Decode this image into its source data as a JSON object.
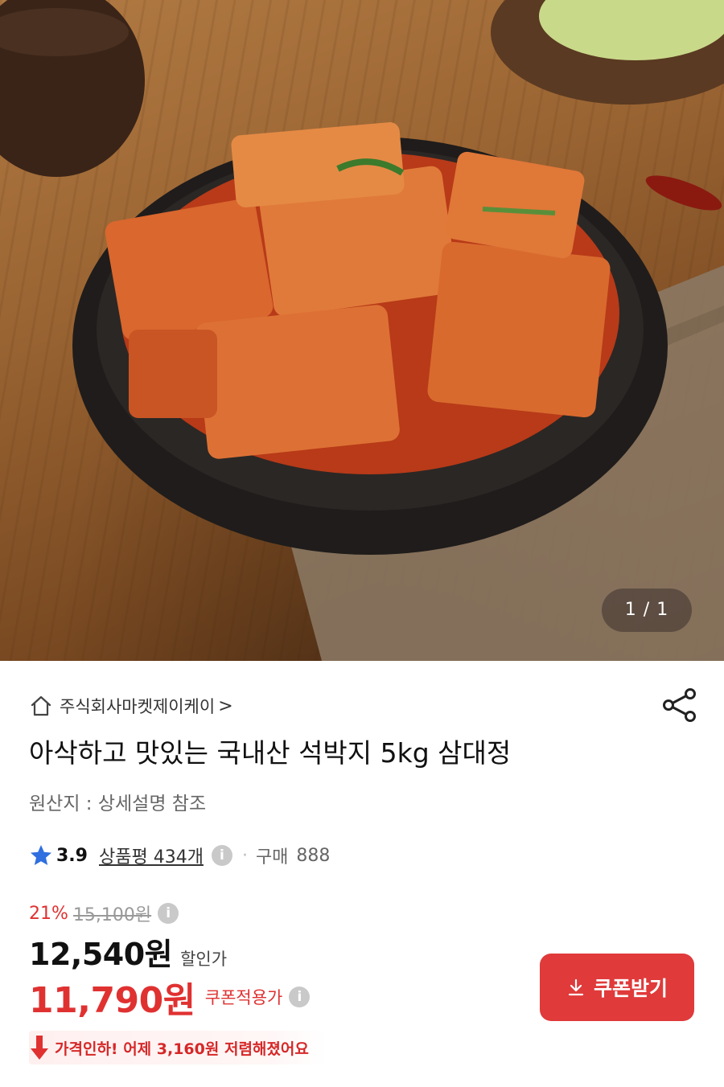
{
  "gallery": {
    "counter": "1 / 1"
  },
  "seller": {
    "name": "주식회사마켓제이케이",
    "chevron": ">"
  },
  "product": {
    "title": "아삭하고 맛있는 국내산 석박지 5kg 삼대정",
    "origin": "원산지 : 상세설명 참조"
  },
  "rating": {
    "score": "3.9",
    "reviews": "상품평 434개",
    "purchase_label": "구매",
    "purchase_count": "888"
  },
  "price": {
    "discount_rate": "21%",
    "original_price": "15,100원",
    "sale_price": "12,540원",
    "sale_label": "할인가",
    "coupon_price": "11,790원",
    "coupon_label": "쿠폰적용가",
    "coupon_button": "쿠폰받기",
    "price_drop_notice": "가격인하! 어제 3,160원 저렴해졌어요"
  },
  "icons": {
    "home": "home-icon",
    "share": "share-icon",
    "star": "star-icon",
    "info": "info-icon",
    "download": "download-icon",
    "down_arrow": "down-arrow-icon"
  },
  "colors": {
    "accent_red": "#e03131",
    "star_blue": "#2f6fe0",
    "button_red": "#e03a3a"
  }
}
